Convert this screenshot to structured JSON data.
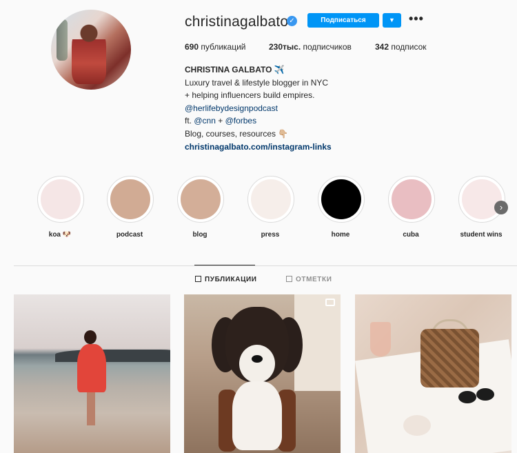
{
  "profile": {
    "username": "christinagalbato",
    "verified_icon": "verified-badge-icon",
    "follow_label": "Подписаться",
    "dropdown_icon": "chevron-down-icon",
    "more_label": "•••",
    "stats": {
      "posts_count": "690",
      "posts_label": "публикаций",
      "followers_count": "230тыс.",
      "followers_label": "подписчиков",
      "following_count": "342",
      "following_label": "подписок"
    },
    "bio": {
      "name": "CHRISTINA GALBATO ✈️",
      "line1": "Luxury travel & lifestyle blogger in NYC",
      "line2": "+ helping influencers build empires.",
      "line3": "@herlifebydesignpodcast",
      "line4_prefix": "ft. ",
      "line4_cnn": "@cnn",
      "line4_plus": " + ",
      "line4_forbes": "@forbes",
      "line5": "Blog, courses, resources 👇🏼",
      "website": "christinagalbato.com/instagram-links"
    }
  },
  "highlights": [
    {
      "label": "koa 🐶",
      "color": "#f5e6e6"
    },
    {
      "label": "podcast",
      "color": "#d1ab94"
    },
    {
      "label": "blog",
      "color": "#d3ae98"
    },
    {
      "label": "press",
      "color": "#f6eeea"
    },
    {
      "label": "home",
      "color": "#000000"
    },
    {
      "label": "cuba",
      "color": "#e9bec2"
    },
    {
      "label": "student wins",
      "color": "#f7e8e8"
    }
  ],
  "tabs": {
    "posts": "ПУБЛИКАЦИИ",
    "tagged": "ОТМЕТКИ"
  },
  "colors": {
    "accent": "#0095f6",
    "link": "#00376b",
    "text": "#262626",
    "background": "#fafafa"
  }
}
